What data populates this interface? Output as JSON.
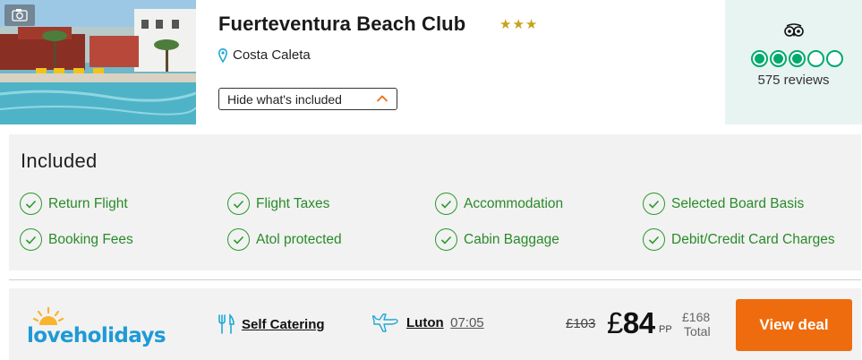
{
  "hotel": {
    "name": "Fuerteventura Beach Club",
    "star_count": 3,
    "location": "Costa Caleta",
    "toggle_label": "Hide what's included",
    "photo_icon": "camera-icon"
  },
  "rating": {
    "provider_icon": "tripadvisor-owl-icon",
    "bubbles_filled": 3,
    "bubbles_total": 5,
    "reviews_label": "575 reviews"
  },
  "included": {
    "title": "Included",
    "items": [
      {
        "label": "Return Flight"
      },
      {
        "label": "Flight Taxes"
      },
      {
        "label": "Accommodation"
      },
      {
        "label": "Selected Board Basis"
      },
      {
        "label": "Booking Fees"
      },
      {
        "label": "Atol protected"
      },
      {
        "label": "Cabin Baggage"
      },
      {
        "label": "Debit/Credit Card Charges"
      }
    ]
  },
  "deal": {
    "provider": "loveholidays",
    "board_basis": "Self Catering",
    "airport": "Luton",
    "departure_time": "07:05",
    "was_price": "£103",
    "currency": "£",
    "price": "84",
    "per_person": "PP",
    "total_price": "£168",
    "total_label": "Total",
    "cta_label": "View deal"
  },
  "colors": {
    "accent_orange": "#ef6c0e",
    "included_green": "#2a9a2a",
    "tripadvisor_green": "#00aa6c",
    "rating_bg": "#e8f4f1",
    "brand_blue": "#1e9ad6",
    "star_gold": "#c7a21a"
  }
}
